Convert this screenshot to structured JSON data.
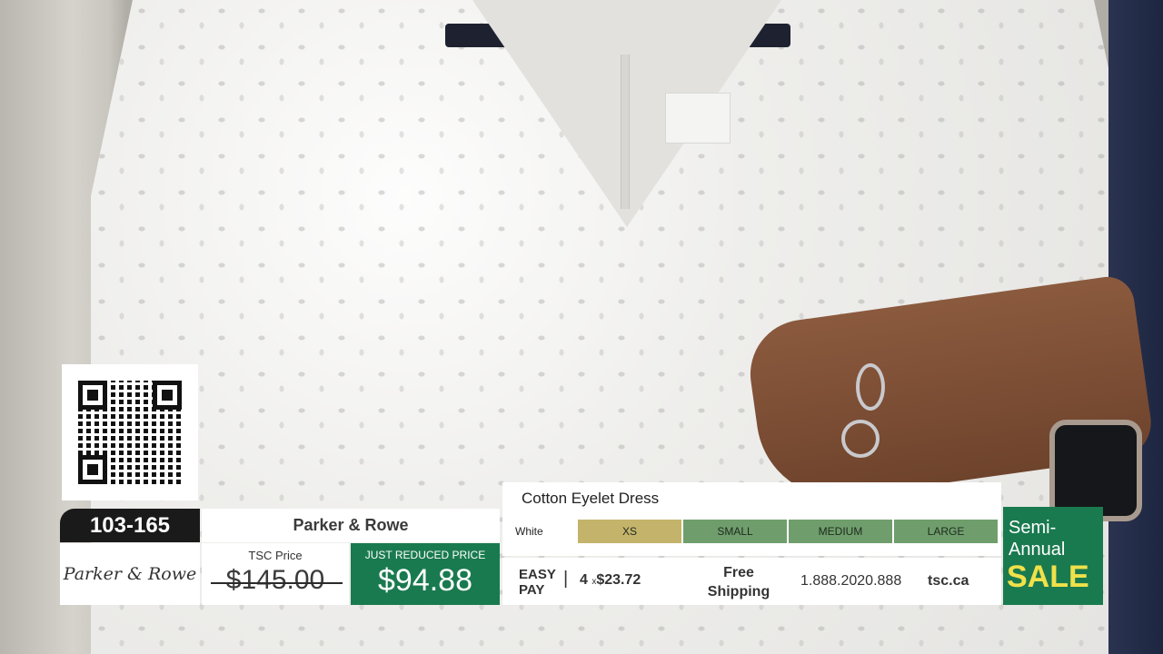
{
  "overlay": {
    "item_number": "103-165",
    "brand_logo_text": "Parker & Rowe",
    "brand_name": "Parker & Rowe",
    "tsc_price_label": "TSC Price",
    "tsc_price_value": "$145.00",
    "reduced_label": "JUST REDUCED PRICE",
    "reduced_value": "$94.88",
    "product_name": "Cotton Eyelet Dress",
    "color_label": "White",
    "sizes": [
      {
        "label": "XS",
        "state": "selected",
        "color": "#c4b36b"
      },
      {
        "label": "SMALL",
        "state": "available",
        "color": "#6f9e6c"
      },
      {
        "label": "MEDIUM",
        "state": "available",
        "color": "#6f9e6c"
      },
      {
        "label": "LARGE",
        "state": "available",
        "color": "#6f9e6c"
      }
    ],
    "easy_pay_line1": "EASY",
    "easy_pay_line2": "PAY",
    "separator": "|",
    "installments_count": "4",
    "installments_x": "x",
    "installments_amount": "$23.72",
    "shipping_line1": "Free",
    "shipping_line2": "Shipping",
    "phone": "1.888.2020.888",
    "website": "tsc.ca",
    "sale_line1": "Semi-",
    "sale_line2": "Annual",
    "sale_line3": "SALE"
  },
  "colors": {
    "brand_green": "#1a7a4f",
    "size_selected": "#c4b36b",
    "size_available": "#6f9e6c",
    "sale_yellow": "#f0e14a"
  },
  "icons": {
    "qr": "qr-code-icon"
  }
}
